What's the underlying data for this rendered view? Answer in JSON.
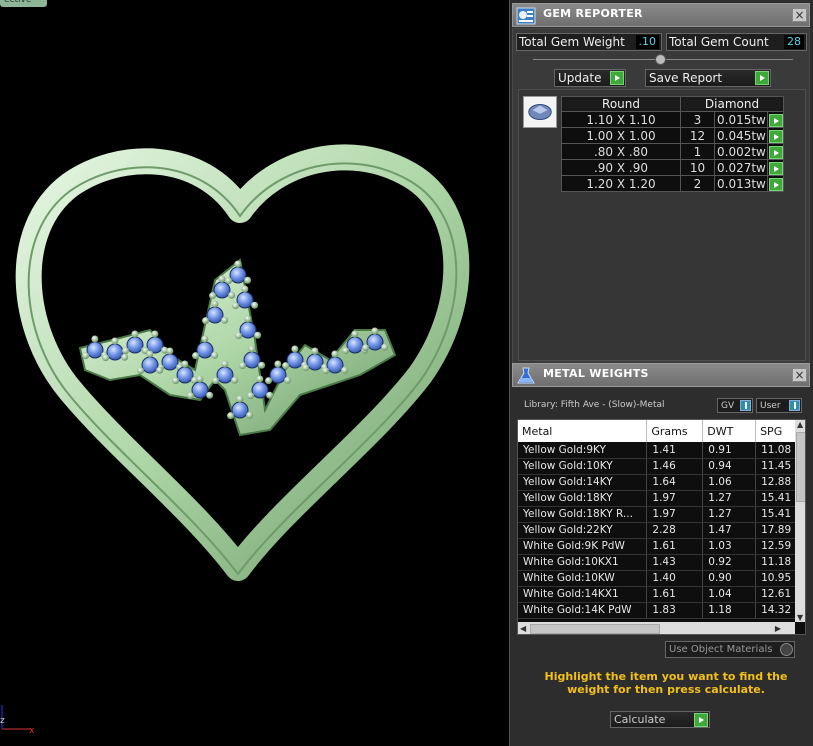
{
  "viewport": {
    "tab_label": "ective",
    "axis_labels": [
      "z",
      "x"
    ]
  },
  "gem_reporter": {
    "title": "GEM REPORTER",
    "close_label": "×",
    "total_gem_weight_label": "Total Gem Weight",
    "total_gem_weight_value": ".10",
    "total_gem_count_label": "Total Gem Count",
    "total_gem_count_value": "28",
    "update_label": "Update",
    "save_report_label": "Save Report",
    "table": {
      "headers": [
        "Round",
        "Diamond"
      ],
      "rows": [
        {
          "size": "1.10 X 1.10",
          "count": "3",
          "tw": "0.015tw"
        },
        {
          "size": "1.00 X 1.00",
          "count": "12",
          "tw": "0.045tw"
        },
        {
          "size": ".80 X .80",
          "count": "1",
          "tw": "0.002tw"
        },
        {
          "size": ".90 X .90",
          "count": "10",
          "tw": "0.027tw"
        },
        {
          "size": "1.20 X 1.20",
          "count": "2",
          "tw": "0.013tw"
        }
      ]
    }
  },
  "metal_weights": {
    "title": "METAL WEIGHTS",
    "close_label": "×",
    "library_label": "Library: Fifth Ave - (Slow)-Metal",
    "gv_label": "GV",
    "user_label": "User",
    "columns": [
      "Metal",
      "Grams",
      "DWT",
      "SPG"
    ],
    "rows": [
      [
        "Yellow Gold:9KY",
        "1.41",
        "0.91",
        "11.08"
      ],
      [
        "Yellow Gold:10KY",
        "1.46",
        "0.94",
        "11.45"
      ],
      [
        "Yellow Gold:14KY",
        "1.64",
        "1.06",
        "12.88"
      ],
      [
        "Yellow Gold:18KY",
        "1.97",
        "1.27",
        "15.41"
      ],
      [
        "Yellow Gold:18KY R...",
        "1.97",
        "1.27",
        "15.41"
      ],
      [
        "Yellow Gold:22KY",
        "2.28",
        "1.47",
        "17.89"
      ],
      [
        "White Gold:9K PdW",
        "1.61",
        "1.03",
        "12.59"
      ],
      [
        "White Gold:10KX1",
        "1.43",
        "0.92",
        "11.18"
      ],
      [
        "White Gold:10KW",
        "1.40",
        "0.90",
        "10.95"
      ],
      [
        "White Gold:14KX1",
        "1.61",
        "1.04",
        "12.61"
      ],
      [
        "White Gold:14K PdW",
        "1.83",
        "1.18",
        "14.32"
      ]
    ],
    "use_object_materials_label": "Use Object Materials",
    "instruction": "Highlight the item you want to find the weight for then press calculate.",
    "calculate_label": "Calculate"
  }
}
